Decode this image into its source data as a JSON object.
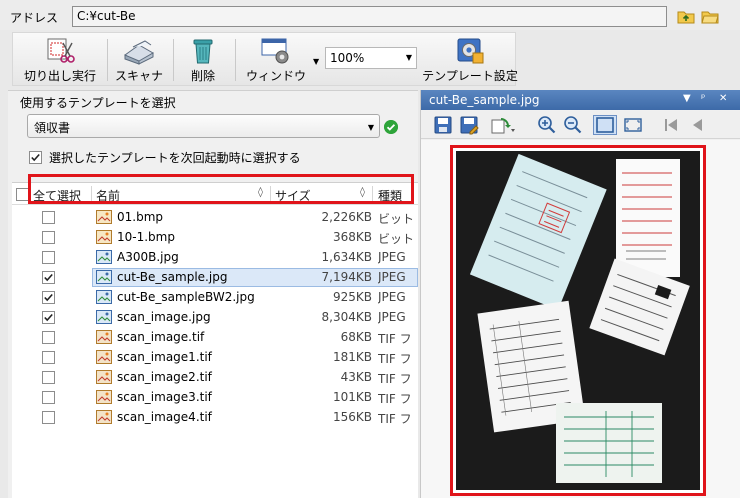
{
  "address": {
    "label": "アドレス",
    "value": "C:¥cut-Be"
  },
  "toolbar": {
    "cut_execute_label": "切り出し実行",
    "scanner_label": "スキャナ",
    "delete_label": "削除",
    "window_label": "ウィンドウ",
    "zoom_value": "100%",
    "template_settings_label": "テンプレート設定"
  },
  "template": {
    "group_title": "使用するテンプレートを選択",
    "selected": "領収書",
    "remember_label": "選択したテンプレートを次回起動時に選択する",
    "remember_checked": true
  },
  "file_list": {
    "headers": {
      "select_all": "全て選択",
      "name": "名前",
      "size": "サイズ",
      "type": "種類"
    },
    "rows": [
      {
        "checked": false,
        "name": "01.bmp",
        "size": "2,226KB",
        "type": "ビット",
        "icon": "bmp-file-icon"
      },
      {
        "checked": false,
        "name": "10-1.bmp",
        "size": "368KB",
        "type": "ビット",
        "icon": "bmp-file-icon"
      },
      {
        "checked": false,
        "name": "A300B.jpg",
        "size": "1,634KB",
        "type": "JPEG",
        "icon": "jpeg-file-icon"
      },
      {
        "checked": true,
        "name": "cut-Be_sample.jpg",
        "size": "7,194KB",
        "type": "JPEG",
        "icon": "jpeg-file-icon",
        "selected": true
      },
      {
        "checked": true,
        "name": "cut-Be_sampleBW2.jpg",
        "size": "925KB",
        "type": "JPEG",
        "icon": "jpeg-file-icon"
      },
      {
        "checked": true,
        "name": "scan_image.jpg",
        "size": "8,304KB",
        "type": "JPEG",
        "icon": "jpeg-file-icon"
      },
      {
        "checked": false,
        "name": "scan_image.tif",
        "size": "68KB",
        "type": "TIF フ",
        "icon": "tif-file-icon"
      },
      {
        "checked": false,
        "name": "scan_image1.tif",
        "size": "181KB",
        "type": "TIF フ",
        "icon": "tif-file-icon"
      },
      {
        "checked": false,
        "name": "scan_image2.tif",
        "size": "43KB",
        "type": "TIF フ",
        "icon": "tif-file-icon"
      },
      {
        "checked": false,
        "name": "scan_image3.tif",
        "size": "101KB",
        "type": "TIF フ",
        "icon": "tif-file-icon"
      },
      {
        "checked": false,
        "name": "scan_image4.tif",
        "size": "156KB",
        "type": "TIF フ",
        "icon": "tif-file-icon"
      }
    ]
  },
  "preview": {
    "title": "cut-Be_sample.jpg"
  },
  "colors": {
    "highlight_red": "#e0141a",
    "title_bar_blue": "#4a78b5",
    "selection_blue": "#dbe8f8"
  }
}
